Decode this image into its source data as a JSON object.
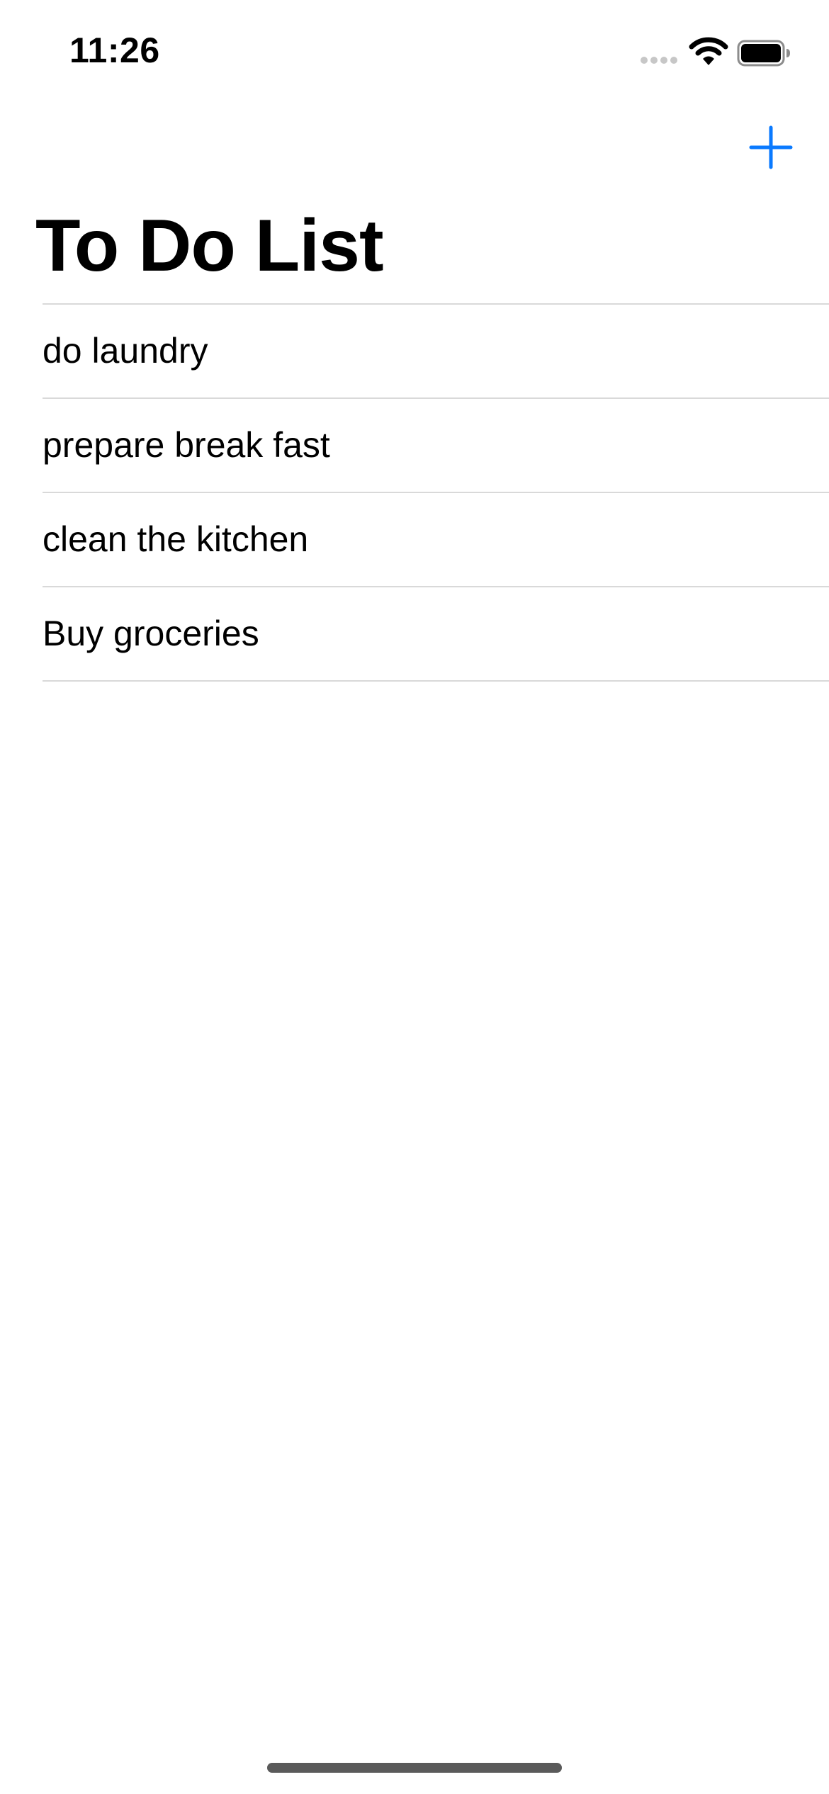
{
  "status_bar": {
    "time": "11:26",
    "icons": [
      "signal-icon",
      "wifi-icon",
      "battery-icon"
    ]
  },
  "nav": {
    "add_icon": "plus-icon",
    "title": "To Do List"
  },
  "todos": [
    {
      "label": "do laundry"
    },
    {
      "label": "prepare break fast"
    },
    {
      "label": "clean the kitchen"
    },
    {
      "label": "Buy groceries"
    }
  ],
  "colors": {
    "accent": "#0a7aff",
    "separator": "#d9d9d9",
    "text": "#000000",
    "background": "#ffffff"
  }
}
